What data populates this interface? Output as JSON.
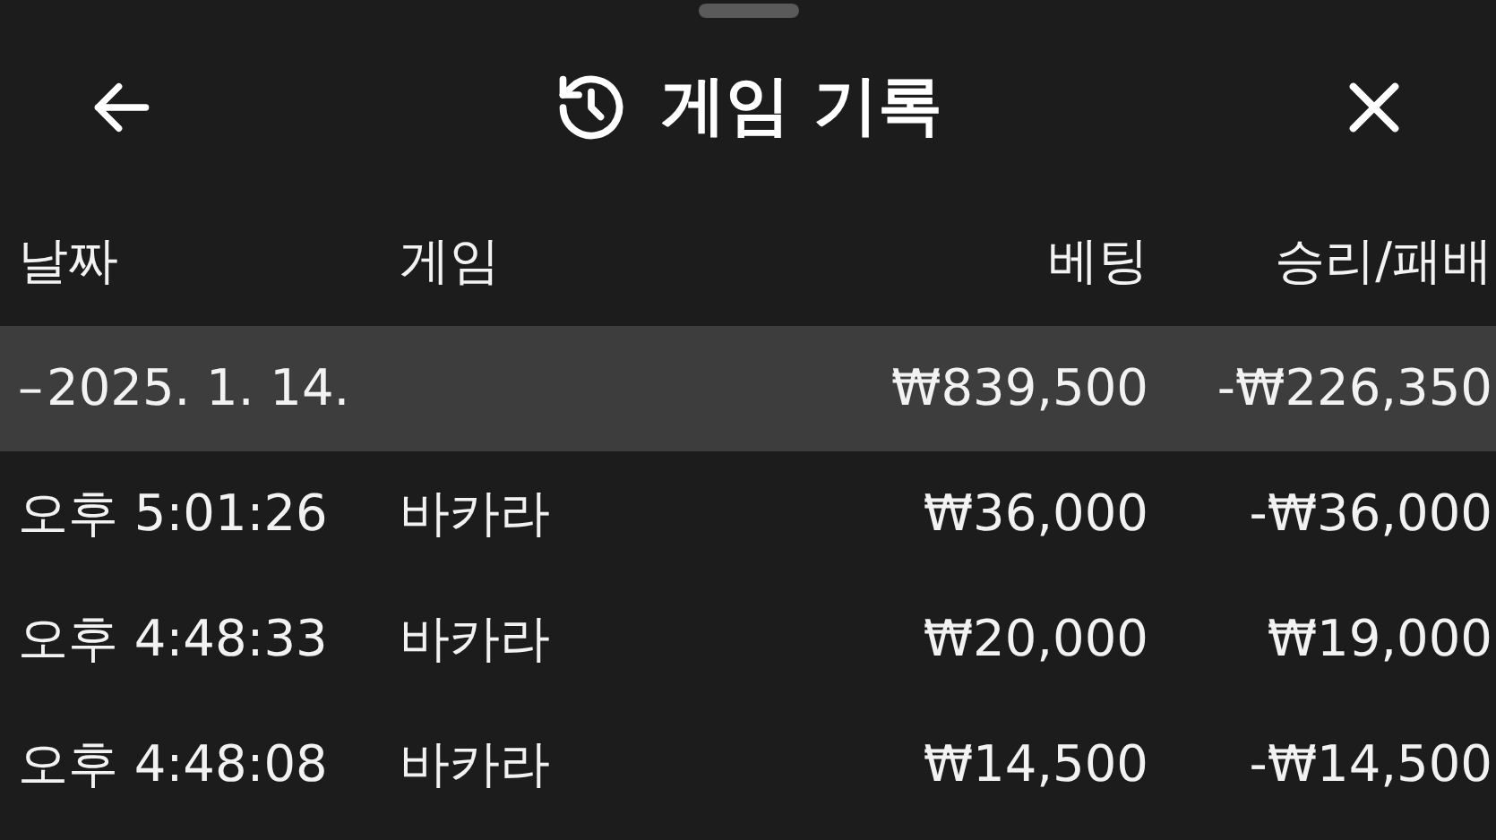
{
  "header": {
    "title": "게임 기록"
  },
  "table": {
    "columns": [
      "날짜",
      "게임",
      "베팅",
      "승리/패배"
    ],
    "group": {
      "toggle": "–",
      "date": "2025. 1. 14.",
      "bet": "₩839,500",
      "result": "-₩226,350"
    },
    "rows": [
      {
        "time": "오후 5:01:26",
        "game": "바카라",
        "bet": "₩36,000",
        "result": "-₩36,000"
      },
      {
        "time": "오후 4:48:33",
        "game": "바카라",
        "bet": "₩20,000",
        "result": "₩19,000"
      },
      {
        "time": "오후 4:48:08",
        "game": "바카라",
        "bet": "₩14,500",
        "result": "-₩14,500"
      }
    ]
  }
}
